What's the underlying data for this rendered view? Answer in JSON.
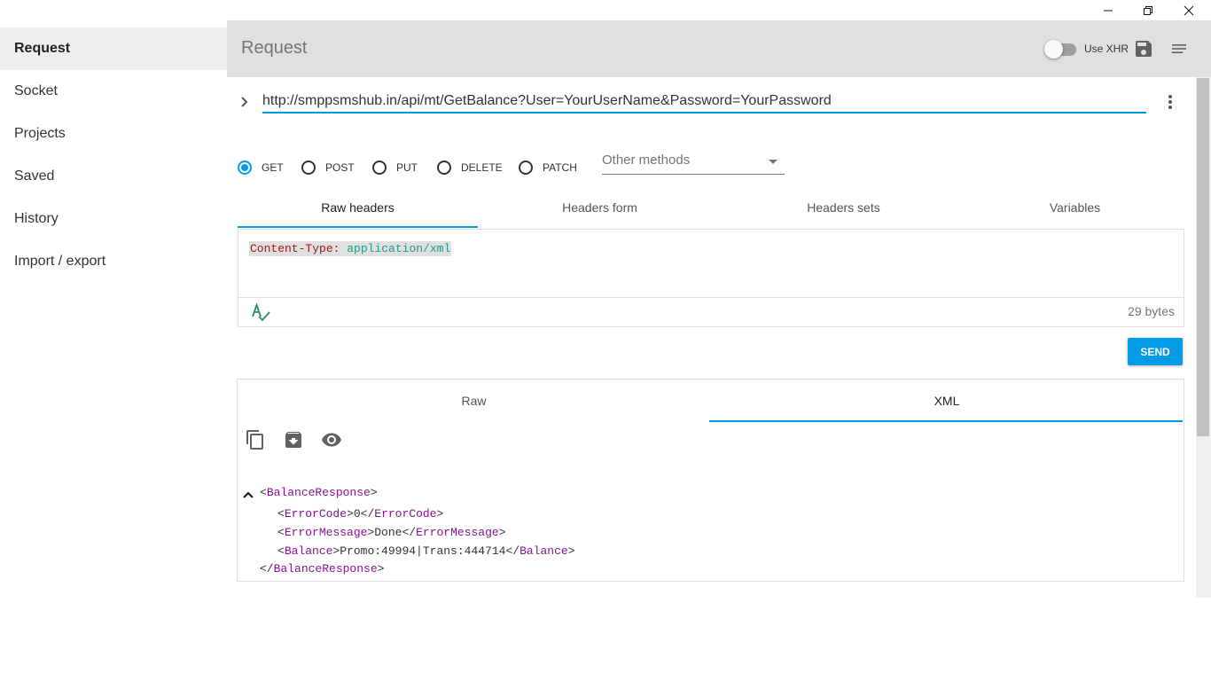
{
  "window": {
    "controls": [
      "minimize-icon",
      "restore-icon",
      "close-icon"
    ]
  },
  "sidebar": {
    "items": [
      {
        "label": "Request",
        "active": true
      },
      {
        "label": "Socket"
      },
      {
        "label": "Projects"
      },
      {
        "label": "Saved"
      },
      {
        "label": "History"
      },
      {
        "label": "Import / export"
      }
    ]
  },
  "header": {
    "title": "Request",
    "xhr_label": "Use XHR",
    "xhr_enabled": false
  },
  "request": {
    "url": "http://smppsmshub.in/api/mt/GetBalance?User=YourUserName&Password=YourPassword",
    "methods": [
      "GET",
      "POST",
      "PUT",
      "DELETE",
      "PATCH"
    ],
    "selected_method": "GET",
    "other_methods_placeholder": "Other methods",
    "header_tabs": [
      "Raw headers",
      "Headers form",
      "Headers sets",
      "Variables"
    ],
    "active_header_tab": "Raw headers",
    "raw_header_key": "Content-Type:",
    "raw_header_value": "application/xml",
    "headers_size": "29 bytes",
    "send_label": "SEND"
  },
  "response": {
    "tabs": [
      "Raw",
      "XML"
    ],
    "active_tab": "XML",
    "xml": {
      "root_open": "BalanceResponse",
      "root_close": "BalanceResponse",
      "children": [
        {
          "tag": "ErrorCode",
          "value": "0"
        },
        {
          "tag": "ErrorMessage",
          "value": "Done"
        },
        {
          "tag": "Balance",
          "value": "Promo:49994|Trans:444714"
        }
      ]
    }
  },
  "colors": {
    "accent": "#039be5",
    "header_bg": "#e0e0e0",
    "xml_tag": "#881391",
    "header_key": "#aa1111",
    "header_value": "#1a9d88"
  }
}
